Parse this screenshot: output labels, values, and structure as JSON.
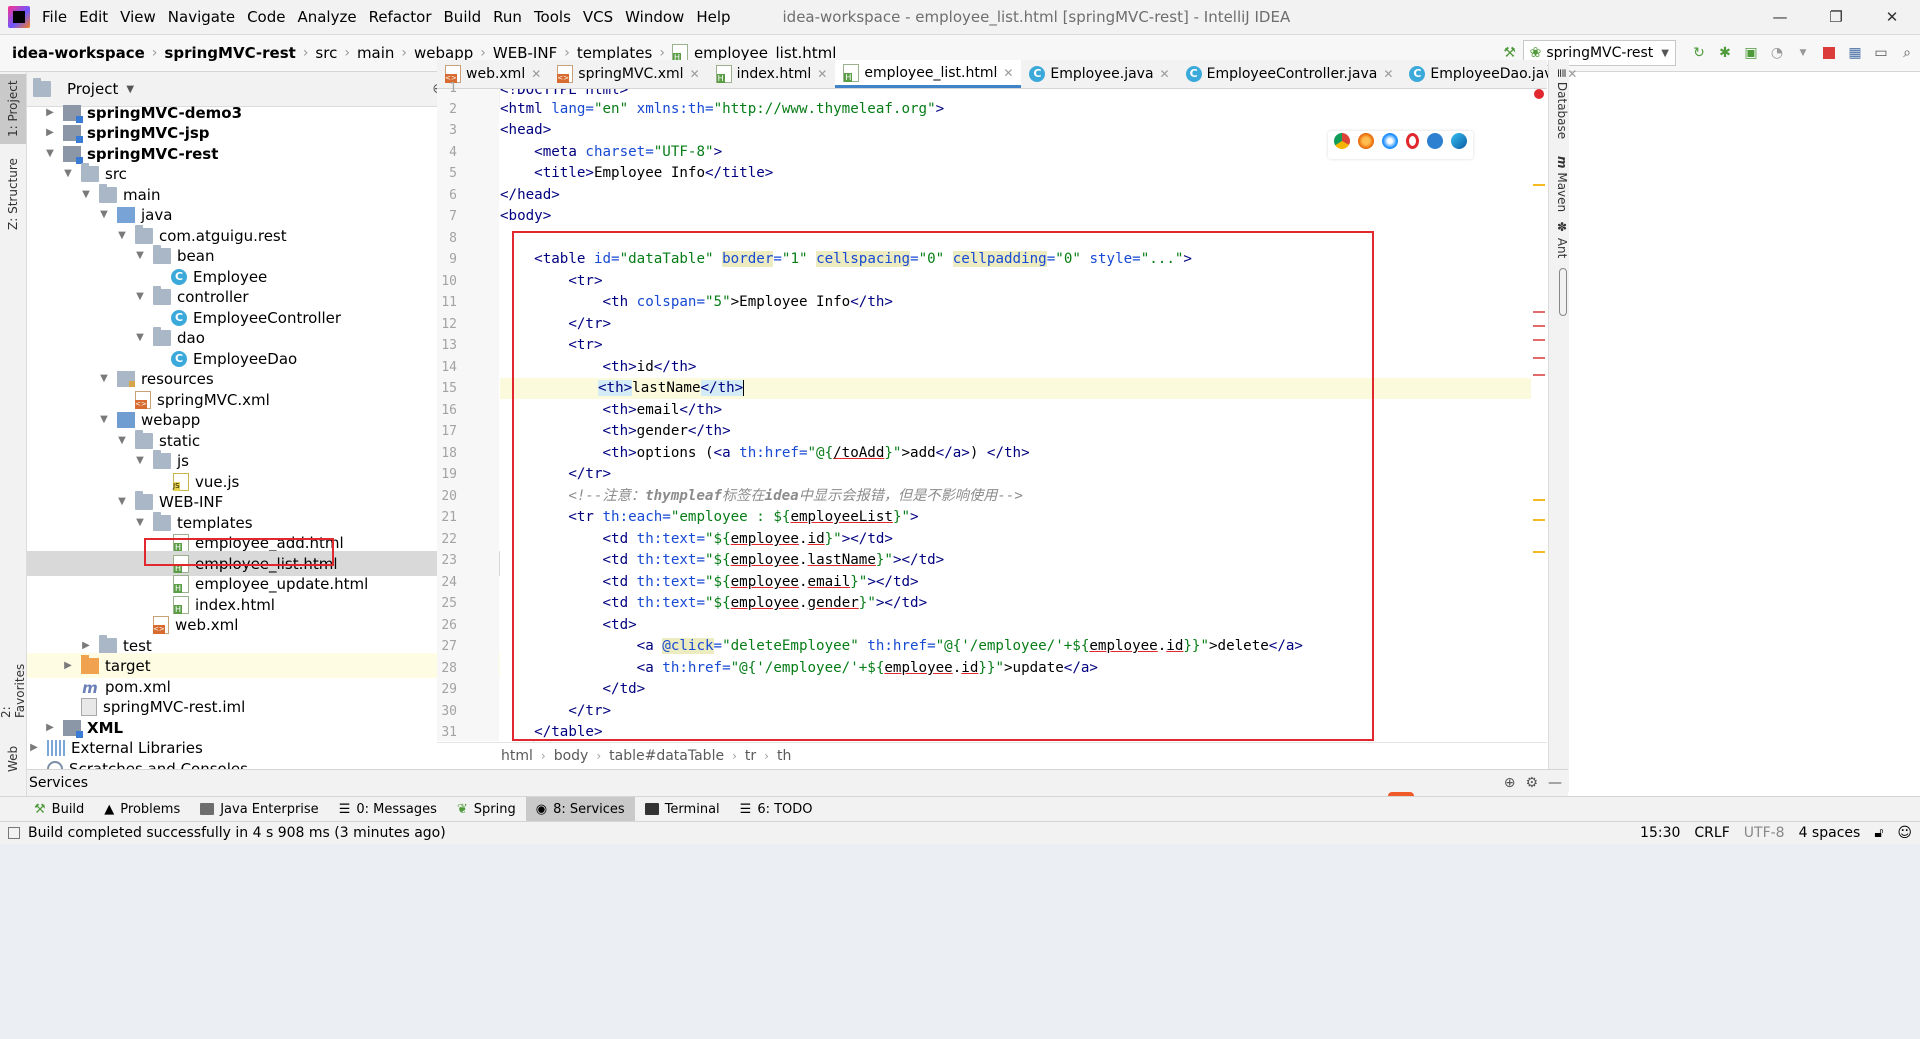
{
  "menubar": {
    "items": [
      "File",
      "Edit",
      "View",
      "Navigate",
      "Code",
      "Analyze",
      "Refactor",
      "Build",
      "Run",
      "Tools",
      "VCS",
      "Window",
      "Help"
    ],
    "window_title": "idea-workspace - employee_list.html [springMVC-rest] - IntelliJ IDEA"
  },
  "navbar": {
    "crumbs": [
      "idea-workspace",
      "springMVC-rest",
      "src",
      "main",
      "webapp",
      "WEB-INF",
      "templates",
      "employee_list.html"
    ],
    "run_config": "springMVC-rest"
  },
  "left_stripe": {
    "project": "1: Project",
    "structure": "Z: Structure",
    "favorites": "2: Favorites",
    "web": "Web"
  },
  "project_panel": {
    "title": "Project",
    "tree": [
      {
        "label": "springMVC-demo3",
        "bold": true
      },
      {
        "label": "springMVC-jsp",
        "bold": true
      },
      {
        "label": "springMVC-rest",
        "bold": true
      },
      {
        "label": "src"
      },
      {
        "label": "main"
      },
      {
        "label": "java"
      },
      {
        "label": "com.atguigu.rest"
      },
      {
        "label": "bean"
      },
      {
        "label": "Employee"
      },
      {
        "label": "controller"
      },
      {
        "label": "EmployeeController"
      },
      {
        "label": "dao"
      },
      {
        "label": "EmployeeDao"
      },
      {
        "label": "resources"
      },
      {
        "label": "springMVC.xml"
      },
      {
        "label": "webapp"
      },
      {
        "label": "static"
      },
      {
        "label": "js"
      },
      {
        "label": "vue.js"
      },
      {
        "label": "WEB-INF"
      },
      {
        "label": "templates"
      },
      {
        "label": "employee_add.html"
      },
      {
        "label": "employee_list.html"
      },
      {
        "label": "employee_update.html"
      },
      {
        "label": "index.html"
      },
      {
        "label": "web.xml"
      },
      {
        "label": "test"
      },
      {
        "label": "target"
      },
      {
        "label": "pom.xml"
      },
      {
        "label": "springMVC-rest.iml"
      },
      {
        "label": "XML",
        "bold": true
      },
      {
        "label": "External Libraries"
      },
      {
        "label": "Scratches and Consoles"
      }
    ]
  },
  "tabs": [
    "web.xml",
    "springMVC.xml",
    "index.html",
    "employee_list.html",
    "Employee.java",
    "EmployeeController.java",
    "EmployeeDao.java"
  ],
  "active_tab": "employee_list.html",
  "code": {
    "line_numbers": [
      "1",
      "2",
      "3",
      "4",
      "5",
      "6",
      "7",
      "8",
      "9",
      "10",
      "11",
      "12",
      "13",
      "14",
      "15",
      "16",
      "17",
      "18",
      "19",
      "20",
      "21",
      "22",
      "23",
      "24",
      "25",
      "26",
      "27",
      "28",
      "29",
      "30",
      "31"
    ],
    "line1": "<!DOCTYPE html>",
    "line2_a": "<html ",
    "line2_b": "lang=",
    "line2_c": "\"en\"",
    "line2_d": " xmlns:th=",
    "line2_e": "\"http://www.thymeleaf.org\"",
    "line2_f": ">",
    "line3": "<head>",
    "line4_a": "    <meta ",
    "line4_b": "charset=",
    "line4_c": "\"UTF-8\"",
    "line4_d": ">",
    "line5_a": "    <title>",
    "line5_b": "Employee Info",
    "line5_c": "</title>",
    "line6": "</head>",
    "line7": "<body>",
    "line9_a": "    <table ",
    "line9_b": "id=",
    "line9_c": "\"dataTable\"",
    "line9_d": "border",
    "line9_e": "=",
    "line9_f": "\"1\"",
    "line9_g": "cellspacing",
    "line9_h": "\"0\"",
    "line9_i": "cellpadding",
    "line9_j": "\"0\"",
    "line9_k": " style=",
    "line9_l": "\"...\"",
    "line9_m": ">",
    "line10": "        <tr>",
    "line11_a": "            <th ",
    "line11_b": "colspan=",
    "line11_c": "\"5\"",
    "line11_d": ">Employee Info",
    "line11_e": "</th>",
    "line12": "        </tr>",
    "line13": "        <tr>",
    "line14_a": "            <th>",
    "line14_b": "id",
    "line14_c": "</th>",
    "line15_a": "<th>",
    "line15_b": "lastName",
    "line15_c": "</th>",
    "line16_a": "            <th>",
    "line16_b": "email",
    "line16_c": "</th>",
    "line17_a": "            <th>",
    "line17_b": "gender",
    "line17_c": "</th>",
    "line18_a": "            <th>",
    "line18_b": "options (",
    "line18_c": "<a ",
    "line18_d": "th:href=",
    "line18_e": "\"@{",
    "line18_f": "/toAdd",
    "line18_g": "}\"",
    "line18_h": ">add",
    "line18_i": "</a>",
    "line18_j": ") ",
    "line18_k": "</th>",
    "line19": "        </tr>",
    "line20_a": "        <!--",
    "line20_b": "注意：",
    "line20_c": "thympleaf",
    "line20_d": "标签在",
    "line20_e": "idea",
    "line20_f": "中显示会报错，但是不影响使用-->",
    "line21_a": "        <tr ",
    "line21_b": "th:each=",
    "line21_c": "\"employee : ${",
    "line21_d": "employeeList",
    "line21_e": "}\"",
    "line21_f": ">",
    "line22_a": "            <td ",
    "line22_b": "th:text=",
    "line22_c": "\"${",
    "line22_d": "employee",
    "line22_e": ".",
    "line22_f": "id",
    "line22_g": "}\"",
    "line22_h": "></td>",
    "line23_a": "            <td ",
    "line23_b": "th:text=",
    "line23_c": "\"${",
    "line23_d": "employee",
    "line23_e": ".",
    "line23_f": "lastName",
    "line23_g": "}\"",
    "line23_h": "></td>",
    "line24_a": "            <td ",
    "line24_b": "th:text=",
    "line24_c": "\"${",
    "line24_d": "employee",
    "line24_e": ".",
    "line24_f": "email",
    "line24_g": "}\"",
    "line24_h": "></td>",
    "line25_a": "            <td ",
    "line25_b": "th:text=",
    "line25_c": "\"${",
    "line25_d": "employee",
    "line25_e": ".",
    "line25_f": "gender",
    "line25_g": "}\"",
    "line25_h": "></td>",
    "line26": "            <td>",
    "line27_a": "                <a ",
    "line27_b": "@click",
    "line27_c": "=",
    "line27_d": "\"deleteEmployee\"",
    "line27_e": " th:href=",
    "line27_f": "\"@{'/employee/'+${",
    "line27_g": "employee",
    "line27_h": ".",
    "line27_i": "id",
    "line27_j": "}}\"",
    "line27_k": ">delete",
    "line27_l": "</a>",
    "line28_a": "                <a ",
    "line28_b": "th:href=",
    "line28_c": "\"@{'/employee/'+${",
    "line28_d": "employee",
    "line28_e": ".",
    "line28_f": "id",
    "line28_g": "}}\"",
    "line28_h": ">update",
    "line28_i": "</a>",
    "line29": "            </td>",
    "line30": "        </tr>",
    "line31": "    </table>"
  },
  "editor_breadcrumbs": [
    "html",
    "body",
    "table#dataTable",
    "tr",
    "th"
  ],
  "right_stripe": {
    "database": "Database",
    "maven": "Maven",
    "ant": "Ant"
  },
  "services": {
    "title": "Services"
  },
  "tool_windows": [
    "Build",
    "Problems",
    "Java Enterprise",
    "0: Messages",
    "Spring",
    "8: Services",
    "Terminal",
    "6: TODO"
  ],
  "active_tool_window": "8: Services",
  "status": {
    "message": "Build completed successfully in 4 s 908 ms (3 minutes ago)",
    "position": "15:30",
    "line_sep": "CRLF",
    "encoding": "UTF-8",
    "indent": "4 spaces"
  },
  "ime": {
    "logo": "S",
    "lang": "中",
    "punct": "°,"
  },
  "colors": {
    "accent": "#4083c9",
    "highlight_box": "#e0282e",
    "tag": "#000080",
    "attr": "#174ad4",
    "string": "#067d17",
    "comment": "#8c8c8c"
  }
}
